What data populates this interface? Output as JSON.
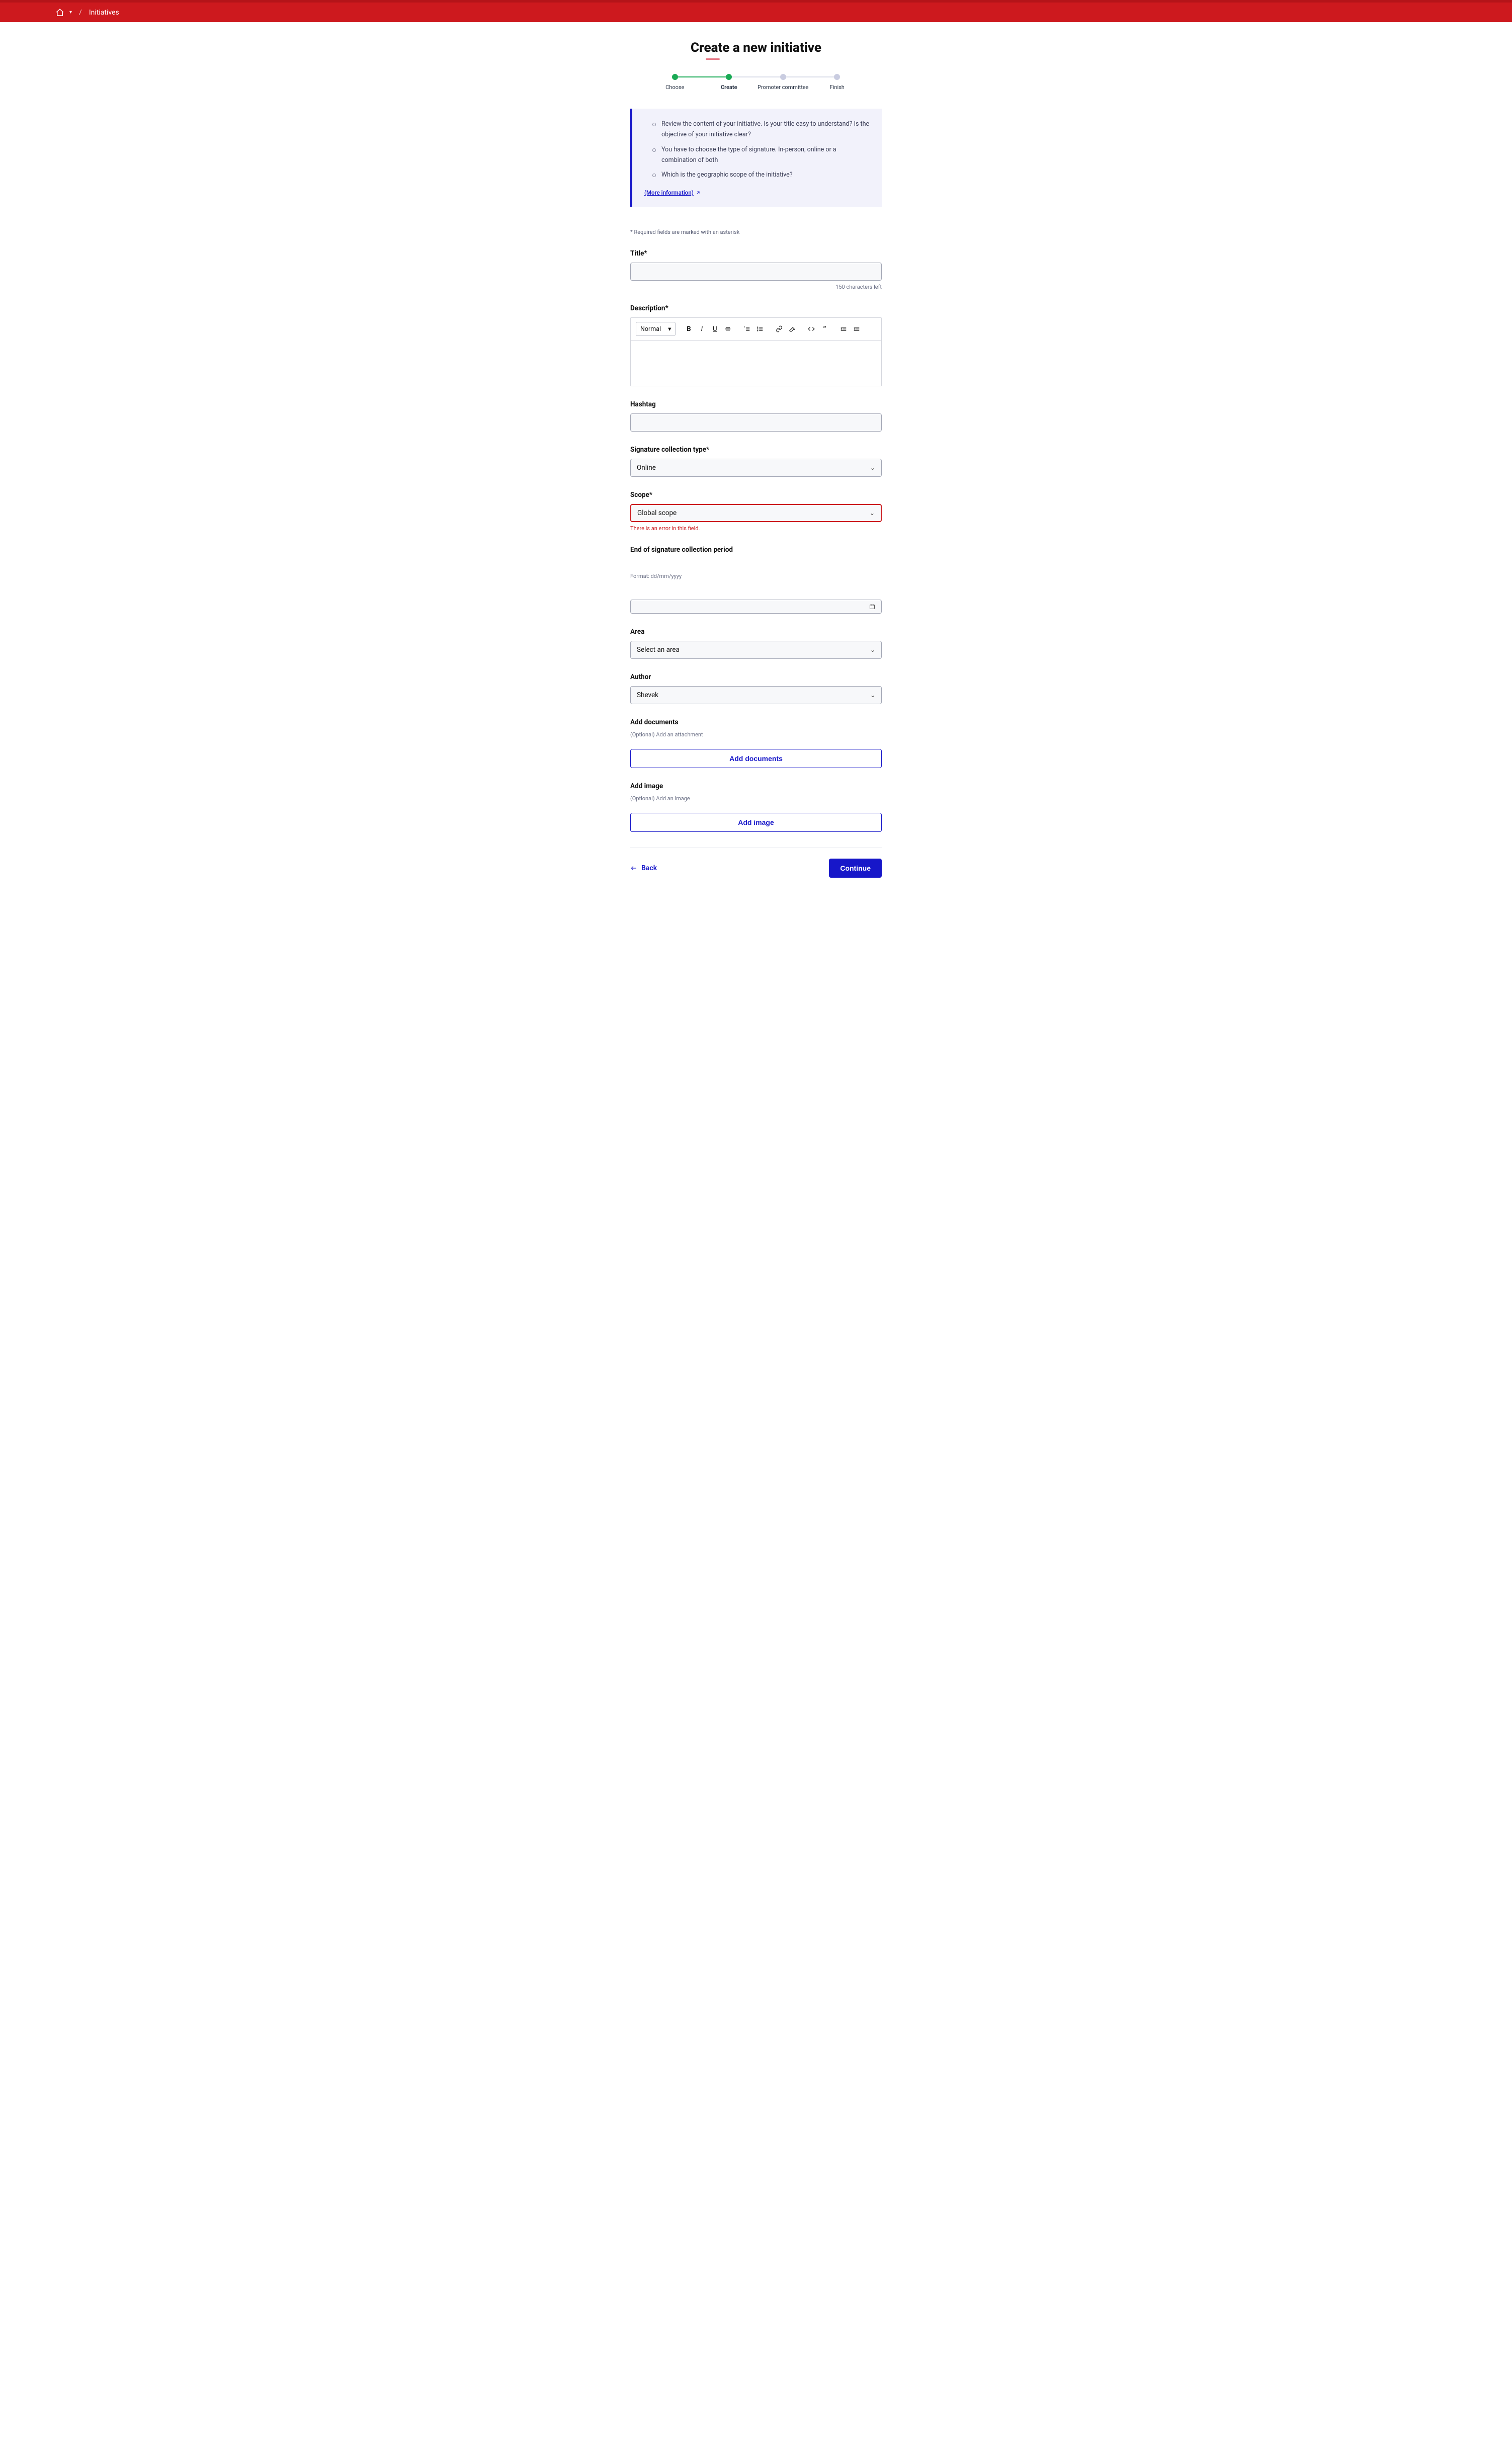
{
  "breadcrumb": {
    "current": "Initiatives"
  },
  "page_title": "Create a new initiative",
  "steps": [
    {
      "label": "Choose",
      "state": "completed"
    },
    {
      "label": "Create",
      "state": "current"
    },
    {
      "label": "Promoter committee",
      "state": "upcoming"
    },
    {
      "label": "Finish",
      "state": "upcoming"
    }
  ],
  "info": {
    "items": [
      "Review the content of your initiative. Is your title easy to understand? Is the objective of your initiative clear?",
      "You have to choose the type of signature. In-person, online or a combination of both",
      "Which is the geographic scope of the initiative?"
    ],
    "more_link": "(More information)"
  },
  "required_note": "* Required fields are marked with an asterisk",
  "fields": {
    "title": {
      "label": "Title*",
      "value": "",
      "chars_left": "150 characters left"
    },
    "description": {
      "label": "Description*",
      "format_select": "Normal"
    },
    "hashtag": {
      "label": "Hashtag",
      "value": ""
    },
    "signature_type": {
      "label": "Signature collection type*",
      "value": "Online"
    },
    "scope": {
      "label": "Scope*",
      "value": "Global scope",
      "error": "There is an error in this field."
    },
    "end_period": {
      "label": "End of signature collection period",
      "format_hint": "Format: dd/mm/yyyy",
      "value": ""
    },
    "area": {
      "label": "Area",
      "value": "Select an area"
    },
    "author": {
      "label": "Author",
      "value": "Shevek"
    },
    "documents": {
      "label": "Add documents",
      "hint": "(Optional) Add an attachment",
      "button": "Add documents"
    },
    "image": {
      "label": "Add image",
      "hint": "(Optional) Add an image",
      "button": "Add image"
    }
  },
  "actions": {
    "back": "Back",
    "continue": "Continue"
  }
}
